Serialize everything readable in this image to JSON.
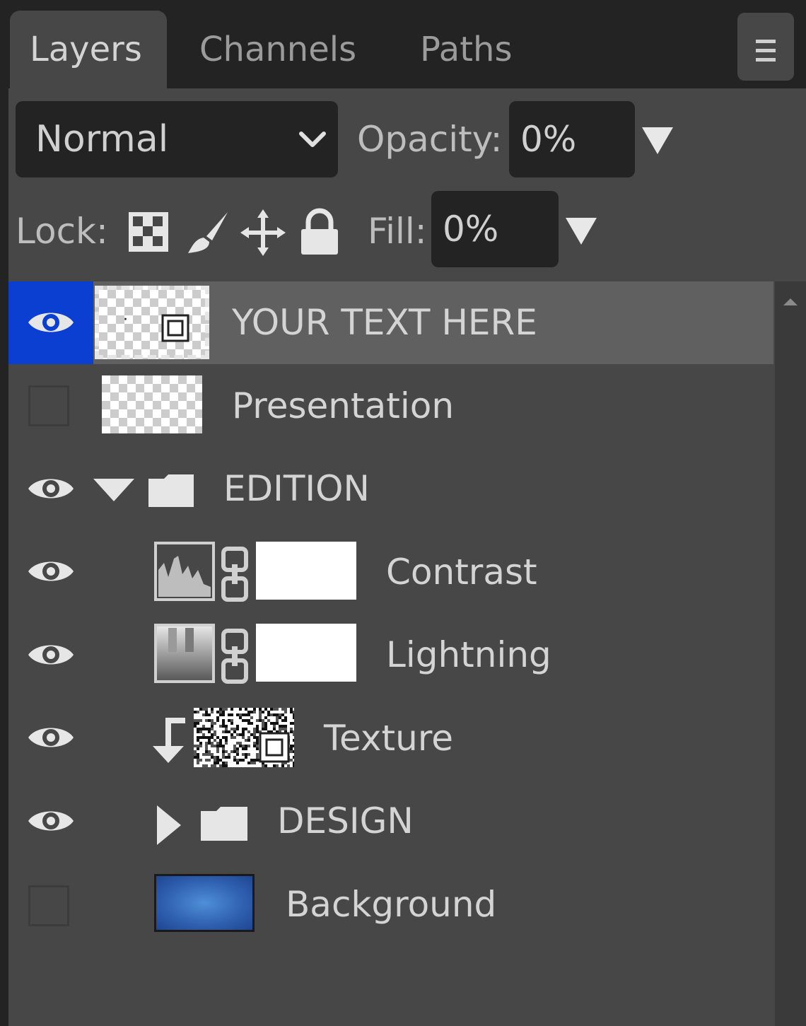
{
  "tabs": [
    {
      "label": "Layers",
      "active": true
    },
    {
      "label": "Channels",
      "active": false
    },
    {
      "label": "Paths",
      "active": false
    }
  ],
  "menu_icon": "hamburger-icon",
  "blend_mode": {
    "value": "Normal"
  },
  "opacity": {
    "label": "Opacity:",
    "value": "0%"
  },
  "lock": {
    "label": "Lock:",
    "icons": [
      "checkerboard-icon",
      "brush-icon",
      "move-icon",
      "lock-icon"
    ]
  },
  "fill": {
    "label": "Fill:",
    "value": "0%"
  },
  "layers": [
    {
      "name": "YOUR TEXT HERE",
      "visible": true,
      "selected": true,
      "type": "smart-object"
    },
    {
      "name": "Presentation",
      "visible": false,
      "type": "transparent"
    },
    {
      "name": "EDITION",
      "visible": true,
      "type": "group",
      "expanded": true
    },
    {
      "name": "Contrast",
      "visible": true,
      "type": "adjustment-levels",
      "indent": 1
    },
    {
      "name": "Lightning",
      "visible": true,
      "type": "adjustment-gradient",
      "indent": 1
    },
    {
      "name": "Texture",
      "visible": true,
      "type": "clipped-smart-object",
      "indent": 1
    },
    {
      "name": "DESIGN",
      "visible": true,
      "type": "group",
      "expanded": false,
      "indent": 1
    },
    {
      "name": "Background",
      "visible": false,
      "type": "image",
      "indent": 1
    }
  ],
  "colors": {
    "selected_eye_bg": "#0a3fd1",
    "panel_bg": "#474747",
    "dark_bg": "#232323"
  }
}
